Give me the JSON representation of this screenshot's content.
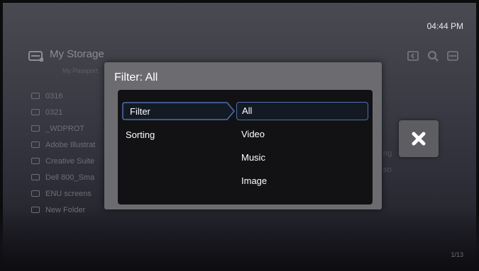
{
  "status_bar": {
    "time": "04:44 PM"
  },
  "storage": {
    "title": "My Storage",
    "subtitle": "My Passport"
  },
  "folders": [
    "0316",
    "0321",
    "_WDPROT",
    "Adobe Illustrat",
    "Creative Suite",
    "Dell 800_Sma",
    "ENU screens",
    "New Folder"
  ],
  "ghost_texts": [
    "ng",
    "so"
  ],
  "pagination": "1/13",
  "dialog": {
    "title": "Filter: All",
    "menu": [
      {
        "label": "Filter",
        "active": true
      },
      {
        "label": "Sorting",
        "active": false
      }
    ],
    "options": [
      {
        "label": "All",
        "selected": true
      },
      {
        "label": "Video",
        "selected": false
      },
      {
        "label": "Music",
        "selected": false
      },
      {
        "label": "Image",
        "selected": false
      }
    ]
  },
  "icons": {
    "storage": "storage-drive-icon",
    "top": [
      "view-toggle-icon",
      "search-icon",
      "device-icon"
    ],
    "close": "close-icon",
    "folder": "folder-icon"
  },
  "colors": {
    "dialog_bg": "#6c6c70",
    "panel_bg": "#121214",
    "selection": "#4c6fb0",
    "close_bg": "#5d5d62"
  }
}
